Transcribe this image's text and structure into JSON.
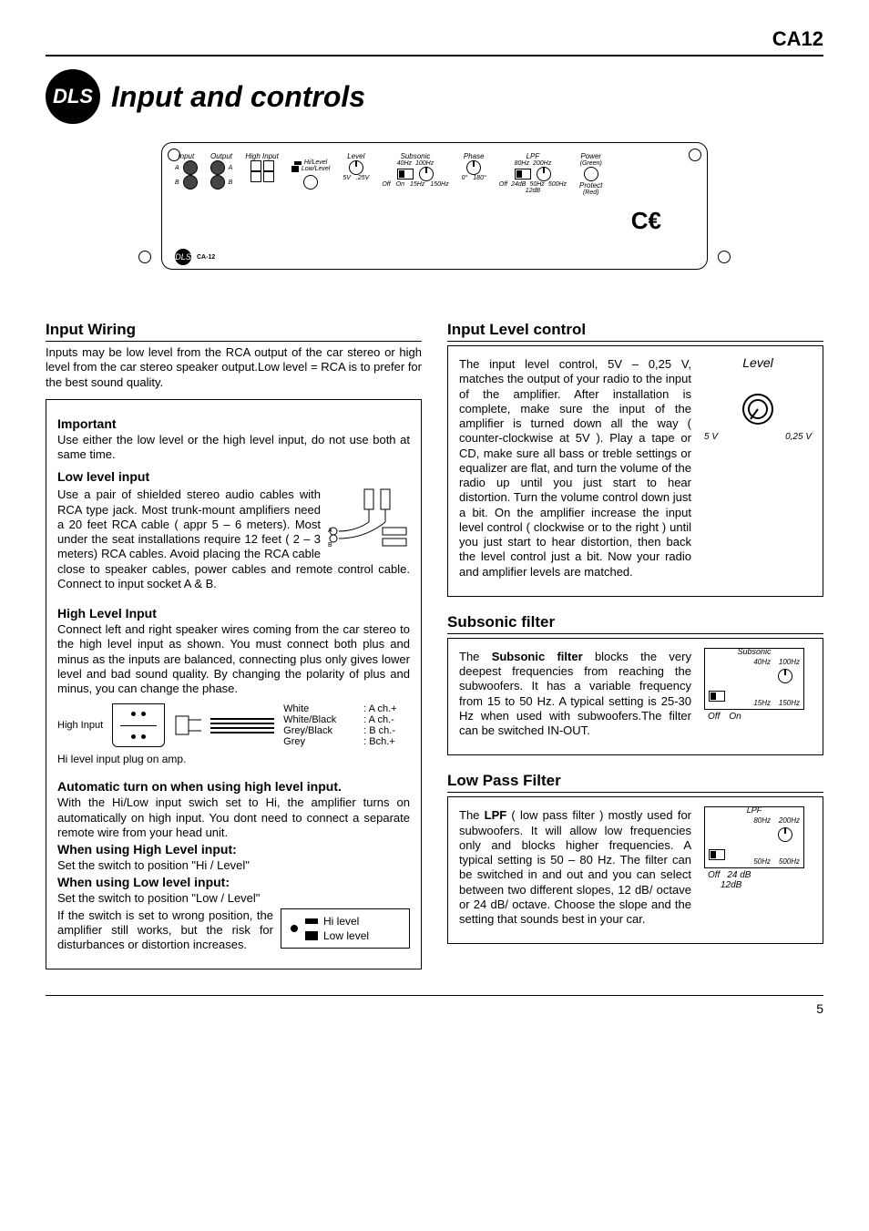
{
  "model": "CA12",
  "logo_text": "DLS",
  "main_title": "Input and controls",
  "page_number": "5",
  "panel": {
    "labels": {
      "input": "Input",
      "output": "Output",
      "high_input": "High Input",
      "hi_level": "Hi/Level",
      "low_level": "Low/Level",
      "level": "Level",
      "l5v": "5V",
      "l025v": ".25V",
      "subsonic": "Subsonic",
      "sub_40": "40Hz",
      "sub_100": "100Hz",
      "sub_15": "15Hz",
      "sub_150": "150Hz",
      "off": "Off",
      "on": "On",
      "phase": "Phase",
      "ph0": "0°",
      "ph180": "180°",
      "lpf": "LPF",
      "lpf_80": "80Hz",
      "lpf_200": "200Hz",
      "lpf_50": "50Hz",
      "lpf_500": "500Hz",
      "lpf_off": "Off",
      "lpf_24": "24dB",
      "lpf_12": "12dB",
      "power": "Power",
      "green": "(Green)",
      "protect": "Protect",
      "red": "(Red)",
      "a": "A",
      "b": "B",
      "ce": "CE",
      "brand": "CA-12"
    }
  },
  "input_wiring": {
    "title": "Input Wiring",
    "intro": "Inputs may be low level from the RCA output of the car stereo or high level from the car stereo speaker output.Low level = RCA is to prefer for the best sound quality.",
    "important_h": "Important",
    "important": "Use either the low level or the high level input, do not use both at same time.",
    "low_h": "Low level input",
    "low_p1": "Use a pair of shielded stereo audio cables with RCA type jack. Most trunk-mount amplifiers need a 20 feet RCA cable ( appr 5 – 6 meters). Most under the seat installations require 12 feet ( 2 – 3 meters) RCA cables. Avoid placing the RCA cable close to speaker cables, power cables and remote control cable. Connect to input socket A & B.",
    "high_h": "High Level Input",
    "high_p": "Connect left and right speaker wires coming from the car stereo to the high level input as shown. You must connect both plus and minus as the inputs are balanced, connecting plus only gives lower level and bad sound quality. By changing the polarity of plus and minus, you can change the phase.",
    "hi_input_lbl": "High Input",
    "wires": [
      {
        "name": "White",
        "ch": ": A ch.+"
      },
      {
        "name": "White/Black",
        "ch": ": A ch.-"
      },
      {
        "name": "Grey/Black",
        "ch": ": B ch.-"
      },
      {
        "name": "Grey",
        "ch": ": Bch.+"
      }
    ],
    "plug_caption": "Hi level input plug on amp.",
    "auto_h": "Automatic turn on when using high level input.",
    "auto_p": "With the Hi/Low input swich set to Hi, the amplifier turns on automatically on high input. You dont need to connect a separate remote wire from your head unit.",
    "when_hi_h": "When using High Level input:",
    "when_hi_p": "Set the switch to position \"Hi / Level\"",
    "when_lo_h": "When using Low level input:",
    "when_lo_p": "Set the switch to position \"Low / Level\"",
    "when_wrong": "If the switch is set to wrong position, the amplifier still works, but the risk for disturbances or distortion increases.",
    "sw_hi": "Hi level",
    "sw_lo": "Low level"
  },
  "level": {
    "title": "Input Level control",
    "p": "The input level control, 5V – 0,25 V, matches the output of your radio to the input of the amplifier. After installation is complete, make sure the input of the amplifier is turned down all the way ( counter-clockwise at 5V ). Play a tape or CD, make sure all bass or treble settings or equalizer are flat, and turn the volume of the radio up until you just start to hear distortion. Turn the volume control down just a bit. On the amplifier increase the input level control ( clockwise or to the right ) until you just start to hear distortion, then back the level control just a bit. Now your radio and amplifier levels are matched.",
    "diag_lbl": "Level",
    "diag_l": "5 V",
    "diag_r": "0,25 V"
  },
  "subsonic": {
    "title": "Subsonic filter",
    "p": "The Subsonic filter blocks the very deepest frequencies from reaching the subwoofers. It has a variable frequency from 15 to 50 Hz. A typical setting is 25-30 Hz when used with subwoofers.The filter can be switched IN-OUT.",
    "bold": "Subsonic filter",
    "diag": {
      "top": "Subsonic",
      "t1": "40Hz",
      "t2": "100Hz",
      "b1": "15Hz",
      "b2": "150Hz",
      "off": "Off",
      "on": "On"
    }
  },
  "lpf": {
    "title": "Low Pass Filter",
    "p": "The LPF ( low pass filter ) mostly used for subwoofers. It will allow low frequencies only and blocks higher frequencies. A typical setting is 50 – 80 Hz. The filter can be switched in and out and you can select between two different slopes, 12 dB/ octave or 24 dB/ octave. Choose the slope and the setting that sounds best in your car.",
    "bold": "LPF",
    "diag": {
      "top": "LPF",
      "t1": "80Hz",
      "t2": "200Hz",
      "b1": "50Hz",
      "b2": "500Hz",
      "off": "Off",
      "s24": "24 dB",
      "s12": "12dB"
    }
  }
}
